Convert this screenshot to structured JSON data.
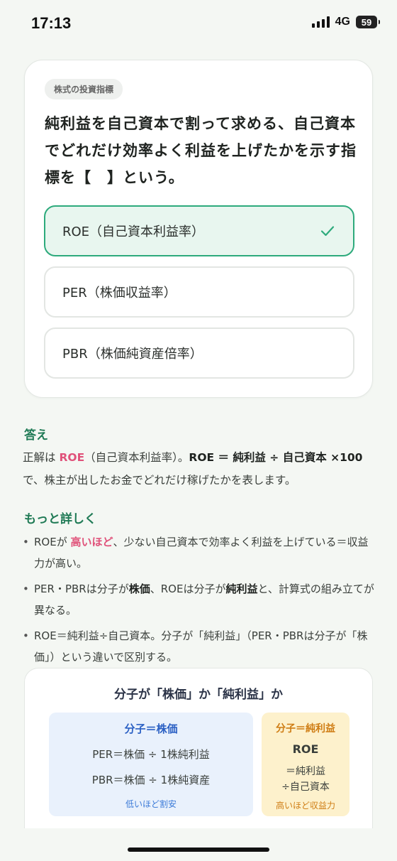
{
  "status": {
    "time": "17:13",
    "network": "4G",
    "battery": "59"
  },
  "quiz": {
    "category": "株式の投資指標",
    "question": "純利益を自己資本で割って求める、自己資本でどれだけ効率よく利益を上げたかを示す指標を【　】という。",
    "options": [
      {
        "label": "ROE（自己資本利益率）",
        "selected": true,
        "correct": true
      },
      {
        "label": "PER（株価収益率）",
        "selected": false
      },
      {
        "label": "PBR（株価純資産倍率）",
        "selected": false
      }
    ]
  },
  "answer": {
    "title": "答え",
    "prefix": "正解は",
    "term": "ROE",
    "term_suffix": "（自己資本利益率）。",
    "formula": "ROE ＝ 純利益 ÷ 自己資本 ×100",
    "rest": "で、株主が出したお金でどれだけ稼げたかを表します。"
  },
  "details": {
    "title": "もっと詳しく",
    "b1_a": "ROEが",
    "b1_hl": "高いほど",
    "b1_b": "、少ない自己資本で効率よく利益を上げている＝収益力が高い。",
    "b2_a": "PER・PBRは分子が",
    "b2_bold1": "株価",
    "b2_b": "、ROEは分子が",
    "b2_bold2": "純利益",
    "b2_c": "と、計算式の組み立てが異なる。",
    "b3": "ROE＝純利益÷自己資本。分子が「純利益」（PER・PBRは分子が「株価」）という違いで区別する。"
  },
  "diagram": {
    "title": "分子が「株価」か「純利益」か",
    "blue": {
      "title": "分子＝株価",
      "line1": "PER＝株価 ÷ 1株純利益",
      "line2": "PBR＝株価 ÷ 1株純資産",
      "note": "低いほど割安"
    },
    "yellow": {
      "title": "分子＝純利益",
      "heading": "ROE",
      "line1": "＝純利益",
      "line2": "÷自己資本",
      "note": "高いほど収益力"
    }
  },
  "colors": {
    "accent_green": "#2daa7c",
    "title_green": "#1f7a55",
    "highlight_pink": "#e0527a",
    "blue": "#2c61c4",
    "orange": "#cf7d14"
  }
}
